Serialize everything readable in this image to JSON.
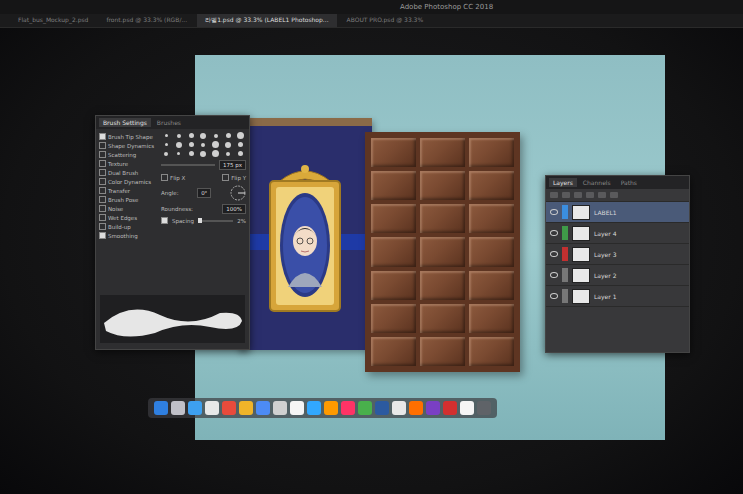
{
  "window": {
    "title": "Adobe Photoshop CC 2018"
  },
  "tabs": [
    {
      "label": "Flat_bus_Mockup_2.psd",
      "selected": false
    },
    {
      "label": "front.psd @ 33.3% (RGB/...",
      "selected": false
    },
    {
      "label": "라벨1.psd @ 33.3% (LABEL1 Photoshop...",
      "selected": true
    },
    {
      "label": "ABOUT PRO.psd @ 33.3%",
      "selected": false
    }
  ],
  "brush_panel": {
    "tabs": [
      {
        "label": "Brush Settings",
        "selected": true
      },
      {
        "label": "Brushes",
        "selected": false
      }
    ],
    "options": [
      {
        "label": "Brush Tip Shape",
        "checked": true
      },
      {
        "label": "Shape Dynamics",
        "checked": false
      },
      {
        "label": "Scattering",
        "checked": false
      },
      {
        "label": "Texture",
        "checked": false
      },
      {
        "label": "Dual Brush",
        "checked": false
      },
      {
        "label": "Color Dynamics",
        "checked": false
      },
      {
        "label": "Transfer",
        "checked": false
      },
      {
        "label": "Brush Pose",
        "checked": false
      },
      {
        "label": "Noise",
        "checked": false
      },
      {
        "label": "Wet Edges",
        "checked": false
      },
      {
        "label": "Build-up",
        "checked": false
      },
      {
        "label": "Smoothing",
        "checked": true
      }
    ],
    "size": "175 px",
    "flip": [
      "Flip X",
      "Flip Y"
    ],
    "angle": "Angle:",
    "angle_value": "0°",
    "roundness": "Roundness:",
    "roundness_value": "100%",
    "spacing": {
      "label": "Spacing",
      "checked": true,
      "value": "2%",
      "level": 0.05
    }
  },
  "layers_panel": {
    "tabs": [
      {
        "label": "Layers",
        "selected": true
      },
      {
        "label": "Channels",
        "selected": false
      },
      {
        "label": "Paths",
        "selected": false
      }
    ],
    "layers": [
      {
        "name": "LABEL1",
        "color": "#3b8ee0",
        "selected": true,
        "visible": true
      },
      {
        "name": "Layer 4",
        "color": "#3f9a48",
        "selected": false,
        "visible": true
      },
      {
        "name": "Layer 3",
        "color": "#c23030",
        "selected": false,
        "visible": true
      },
      {
        "name": "Layer 2",
        "color": "#777777",
        "selected": false,
        "visible": true
      },
      {
        "name": "Layer 1",
        "color": "#777777",
        "selected": false,
        "visible": true
      }
    ]
  },
  "dock": [
    {
      "color": "#2f7fe0"
    },
    {
      "color": "#c0c0c8"
    },
    {
      "color": "#3da0f0"
    },
    {
      "color": "#e8e8e8"
    },
    {
      "color": "#e84b3c"
    },
    {
      "color": "#f0b429"
    },
    {
      "color": "#4c8bf5"
    },
    {
      "color": "#d0d0d0"
    },
    {
      "color": "#f5f5f5"
    },
    {
      "color": "#31a8ff"
    },
    {
      "color": "#ff9a00"
    },
    {
      "color": "#ff3366"
    },
    {
      "color": "#49b04c"
    },
    {
      "color": "#2c5aa0"
    },
    {
      "color": "#e8e8e8"
    },
    {
      "color": "#ff6f00"
    },
    {
      "color": "#7a3fc4"
    },
    {
      "color": "#d32f2f"
    },
    {
      "color": "#f5f5f5"
    },
    {
      "color": "#5f6368"
    }
  ]
}
